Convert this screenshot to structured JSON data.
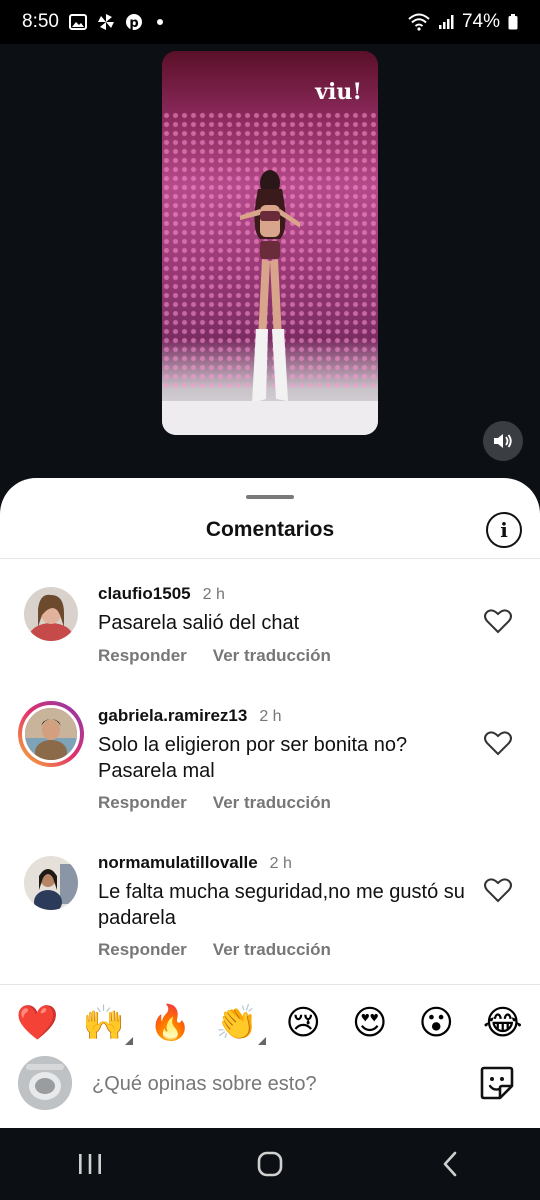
{
  "status_bar": {
    "time": "8:50",
    "battery": "74%"
  },
  "video": {
    "logo": "viu!"
  },
  "sheet": {
    "title": "Comentarios"
  },
  "comments": [
    {
      "username": "claufio1505",
      "time": "2 h",
      "text": "Pasarela salió del chat",
      "reply_label": "Responder",
      "translate_label": "Ver traducción"
    },
    {
      "username": "gabriela.ramirez13",
      "time": "2 h",
      "text": "Solo la eligieron por ser bonita no? Pasarela mal",
      "reply_label": "Responder",
      "translate_label": "Ver traducción"
    },
    {
      "username": "normamulatillovalle",
      "time": "2 h",
      "text": "Le falta mucha seguridad,no me gustó su padarela",
      "reply_label": "Responder",
      "translate_label": "Ver traducción"
    }
  ],
  "emoji_bar": [
    "❤️",
    "🙌",
    "🔥",
    "👏",
    "😢",
    "😍",
    "😮",
    "😂"
  ],
  "composer": {
    "placeholder": "¿Qué opinas sobre esto?"
  },
  "colors": {
    "background": "#0c0f14",
    "sheet": "#ffffff",
    "text_primary": "#111111",
    "text_secondary": "#777777",
    "story_ring": "#e1306c"
  }
}
